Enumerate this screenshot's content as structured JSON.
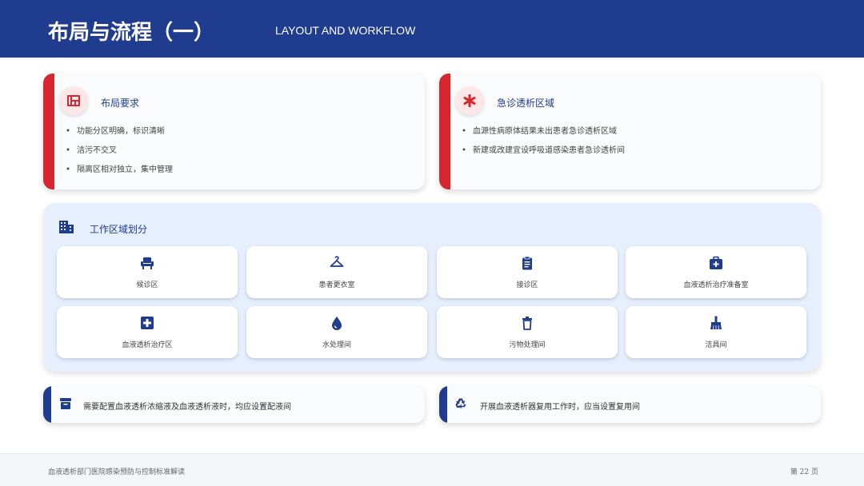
{
  "header": {
    "title": "布局与流程（一）",
    "subtitle": "LAYOUT AND WORKFLOW"
  },
  "layout_card": {
    "title": "布局要求",
    "icon": "layout-icon",
    "items": [
      "功能分区明确，标识清晰",
      "洁污不交叉",
      "隔离区相对独立，集中管理"
    ]
  },
  "emergency_card": {
    "title": "急诊透析区域",
    "icon": "asterisk-icon",
    "items": [
      "血源性病原体结果未出患者急诊透析区域",
      "新建或改建宜设呼吸道感染患者急诊透析间"
    ]
  },
  "work_area": {
    "title": "工作区域划分",
    "icon": "building-icon",
    "tiles": [
      {
        "label": "候诊区",
        "icon": "chair-icon"
      },
      {
        "label": "患者更衣室",
        "icon": "hanger-icon"
      },
      {
        "label": "接诊区",
        "icon": "clipboard-icon"
      },
      {
        "label": "血液透析治疗准备室",
        "icon": "medical-kit-icon"
      },
      {
        "label": "血液透析治疗区",
        "icon": "medical-plus-icon"
      },
      {
        "label": "水处理间",
        "icon": "water-drop-icon"
      },
      {
        "label": "污物处理间",
        "icon": "trash-icon"
      },
      {
        "label": "洁具间",
        "icon": "broom-icon"
      }
    ]
  },
  "notes": [
    {
      "text": "需要配置血液透析浓缩液及血液透析液时，均应设置配液间",
      "icon": "archive-icon"
    },
    {
      "text": "开展血液透析器复用工作时，应当设置复用间",
      "icon": "recycle-icon"
    }
  ],
  "footer": {
    "text": "血液透析部门医院感染预防与控制标准解读",
    "page": "第 22 页"
  },
  "colors": {
    "primary": "#1f3c8f",
    "accent_red": "#d7262e",
    "panel_bg": "#e6effd"
  }
}
